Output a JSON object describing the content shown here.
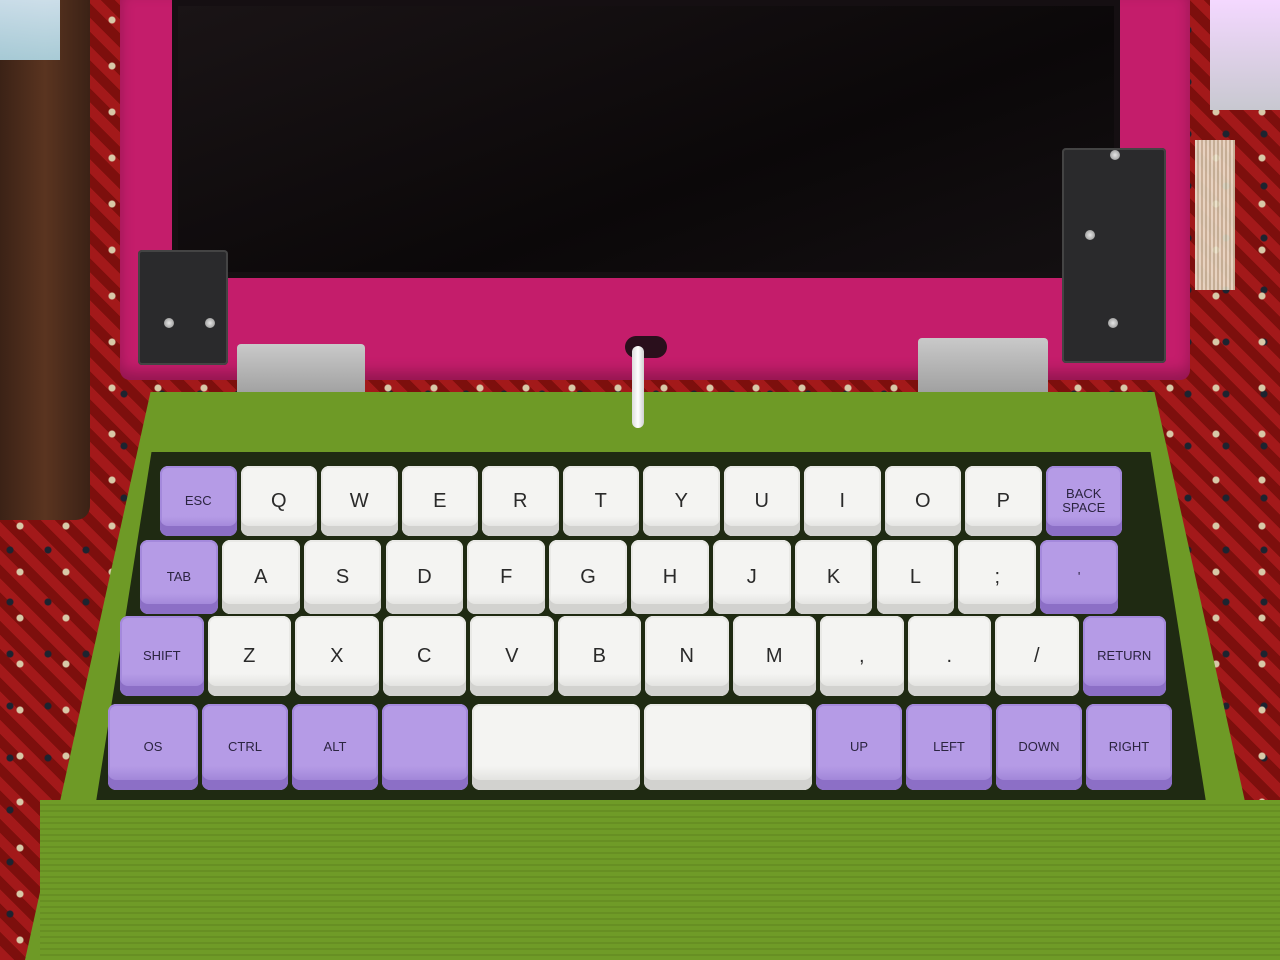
{
  "scene": {
    "description_colors": {
      "lid": "#c41d6b",
      "base": "#6e9a26",
      "modifier_keys": "#b59be6",
      "alpha_keys": "#f4f4f2"
    }
  },
  "keyboard": {
    "rows": [
      {
        "keys": [
          {
            "label": "ESC",
            "kind": "purple"
          },
          {
            "label": "Q",
            "kind": "white"
          },
          {
            "label": "W",
            "kind": "white"
          },
          {
            "label": "E",
            "kind": "white"
          },
          {
            "label": "R",
            "kind": "white"
          },
          {
            "label": "T",
            "kind": "white"
          },
          {
            "label": "Y",
            "kind": "white"
          },
          {
            "label": "U",
            "kind": "white"
          },
          {
            "label": "I",
            "kind": "white"
          },
          {
            "label": "O",
            "kind": "white"
          },
          {
            "label": "P",
            "kind": "white"
          },
          {
            "label": "BACK\nSPACE",
            "kind": "purple"
          }
        ]
      },
      {
        "keys": [
          {
            "label": "TAB",
            "kind": "purple"
          },
          {
            "label": "A",
            "kind": "white"
          },
          {
            "label": "S",
            "kind": "white"
          },
          {
            "label": "D",
            "kind": "white"
          },
          {
            "label": "F",
            "kind": "white"
          },
          {
            "label": "G",
            "kind": "white"
          },
          {
            "label": "H",
            "kind": "white"
          },
          {
            "label": "J",
            "kind": "white"
          },
          {
            "label": "K",
            "kind": "white"
          },
          {
            "label": "L",
            "kind": "white"
          },
          {
            "label": ";",
            "kind": "white"
          },
          {
            "label": "'",
            "kind": "purple"
          }
        ]
      },
      {
        "keys": [
          {
            "label": "SHIFT",
            "kind": "purple"
          },
          {
            "label": "Z",
            "kind": "white"
          },
          {
            "label": "X",
            "kind": "white"
          },
          {
            "label": "C",
            "kind": "white"
          },
          {
            "label": "V",
            "kind": "white"
          },
          {
            "label": "B",
            "kind": "white"
          },
          {
            "label": "N",
            "kind": "white"
          },
          {
            "label": "M",
            "kind": "white"
          },
          {
            "label": ",",
            "kind": "white"
          },
          {
            "label": ".",
            "kind": "white"
          },
          {
            "label": "/",
            "kind": "white"
          },
          {
            "label": "RETURN",
            "kind": "purple"
          }
        ]
      },
      {
        "keys": [
          {
            "label": "OS",
            "kind": "purple"
          },
          {
            "label": "CTRL",
            "kind": "purple"
          },
          {
            "label": "ALT",
            "kind": "purple"
          },
          {
            "label": "",
            "kind": "purple"
          },
          {
            "label": "",
            "kind": "white wide"
          },
          {
            "label": "",
            "kind": "white wide"
          },
          {
            "label": "UP",
            "kind": "purple"
          },
          {
            "label": "LEFT",
            "kind": "purple"
          },
          {
            "label": "DOWN",
            "kind": "purple"
          },
          {
            "label": "RIGHT",
            "kind": "purple"
          }
        ]
      }
    ]
  }
}
